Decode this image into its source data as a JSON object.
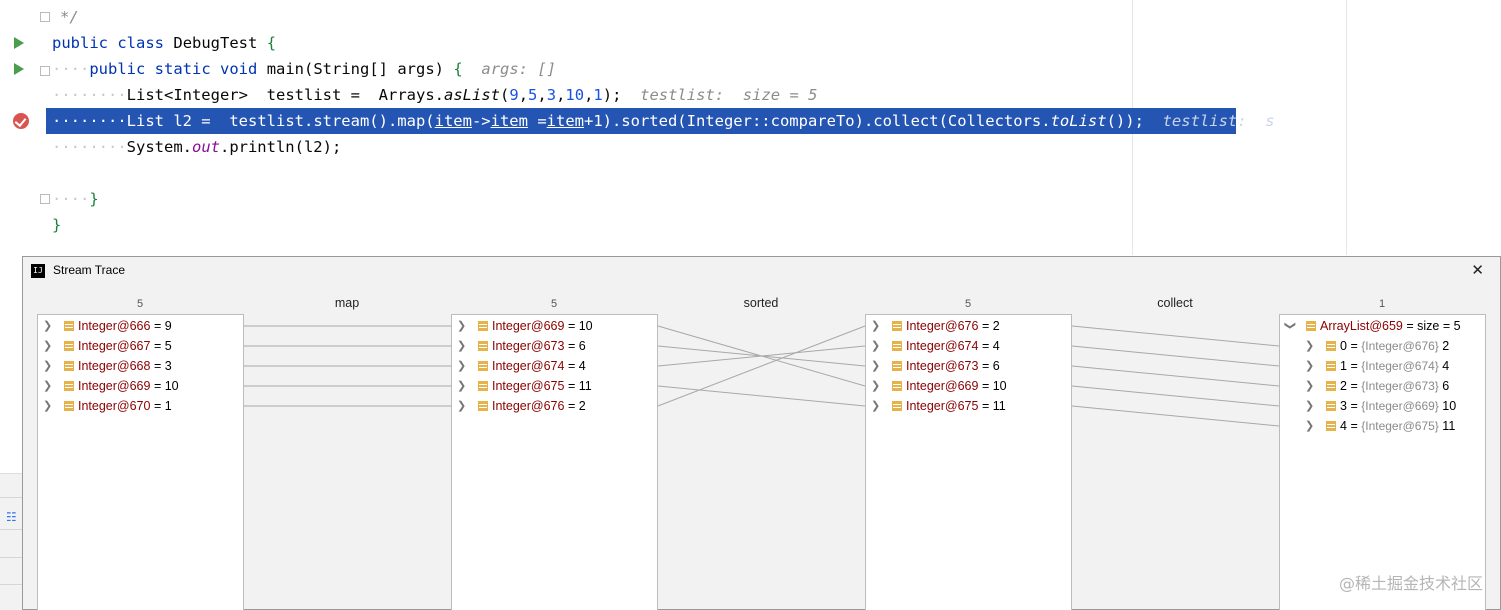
{
  "editor": {
    "lines": {
      "comment_end": "*/",
      "class_public": "public",
      "class_kw": "class",
      "class_name": "DebugTest",
      "class_brace": "{",
      "main_public": "public",
      "main_static": "static",
      "main_void": "void",
      "main_sig": "main(String[] args)",
      "main_brace": "{",
      "main_hint": "args: []",
      "list_decl": "List<Integer>",
      "list_var": "testlist",
      "list_eq": "=",
      "list_call": "Arrays.",
      "list_aslist": "asList",
      "list_open": "(",
      "list_nums": [
        "9",
        "5",
        "3",
        "10",
        "1"
      ],
      "list_close": ");",
      "list_hint_a": "testlist:",
      "list_hint_b": "size = 5",
      "bp_decl": "List l2 =",
      "bp_a": "testlist.stream().map(",
      "bp_item1": "item",
      "bp_arrow": "->",
      "bp_item2": "item",
      "bp_eq": "=",
      "bp_item3": "item",
      "bp_b": "+1).sorted(Integer::compareTo).collect(Collectors.",
      "bp_tolist": "toList",
      "bp_c": "());",
      "bp_hint": "testlist:  s",
      "print_a": "System.",
      "print_out": "out",
      "print_b": ".println(l2);",
      "close_method": "}",
      "close_class": "}"
    }
  },
  "trace": {
    "title": "Stream Trace",
    "close_label": "✕",
    "logo": "IJ",
    "operations": [
      "map",
      "sorted",
      "collect"
    ],
    "columns": [
      {
        "count": "5",
        "rows": [
          {
            "ref": "Integer@666",
            "value": "= 9"
          },
          {
            "ref": "Integer@667",
            "value": "= 5"
          },
          {
            "ref": "Integer@668",
            "value": "= 3"
          },
          {
            "ref": "Integer@669",
            "value": "= 10"
          },
          {
            "ref": "Integer@670",
            "value": "= 1"
          }
        ]
      },
      {
        "count": "5",
        "rows": [
          {
            "ref": "Integer@669",
            "value": "= 10"
          },
          {
            "ref": "Integer@673",
            "value": "= 6"
          },
          {
            "ref": "Integer@674",
            "value": "= 4"
          },
          {
            "ref": "Integer@675",
            "value": "= 11"
          },
          {
            "ref": "Integer@676",
            "value": "= 2"
          }
        ]
      },
      {
        "count": "5",
        "rows": [
          {
            "ref": "Integer@676",
            "value": "= 2"
          },
          {
            "ref": "Integer@674",
            "value": "= 4"
          },
          {
            "ref": "Integer@673",
            "value": "= 6"
          },
          {
            "ref": "Integer@669",
            "value": "= 10"
          },
          {
            "ref": "Integer@675",
            "value": "= 11"
          }
        ]
      },
      {
        "count": "1",
        "root": {
          "ref": "ArrayList@659",
          "value": "=  size = 5"
        },
        "children": [
          {
            "index": "0",
            "eq": "=",
            "ref": "{Integer@676}",
            "value": "2"
          },
          {
            "index": "1",
            "eq": "=",
            "ref": "{Integer@674}",
            "value": "4"
          },
          {
            "index": "2",
            "eq": "=",
            "ref": "{Integer@673}",
            "value": "6"
          },
          {
            "index": "3",
            "eq": "=",
            "ref": "{Integer@669}",
            "value": "10"
          },
          {
            "index": "4",
            "eq": "=",
            "ref": "{Integer@675}",
            "value": "11"
          }
        ]
      }
    ]
  },
  "watermark": "@稀土掘金技术社区",
  "colors": {
    "breakpoint_line": "#2555b3",
    "keyword": "#0033b3",
    "number": "#1750eb",
    "object_ref": "#8b0000",
    "run_icon": "#4a9d4a",
    "breakpoint_icon": "#d9534f"
  }
}
